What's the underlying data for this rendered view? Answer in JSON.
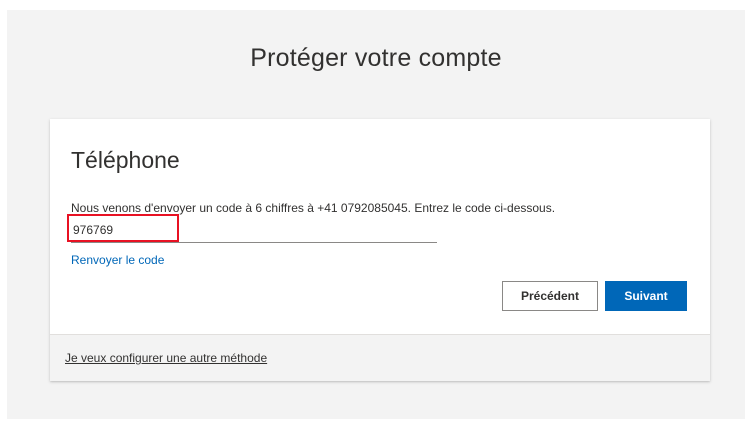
{
  "page": {
    "title": "Protéger votre compte"
  },
  "card": {
    "title": "Téléphone",
    "instruction": "Nous venons d'envoyer un code à 6 chiffres à +41 0792085045. Entrez le code ci-dessous.",
    "code_input": {
      "value": "976769",
      "placeholder": ""
    },
    "resend_link": "Renvoyer le code",
    "buttons": {
      "previous": "Précédent",
      "next": "Suivant"
    },
    "footer": {
      "other_method_link": "Je veux configurer une autre méthode"
    }
  },
  "colors": {
    "accent": "#0067b8",
    "highlight": "#e81123",
    "background": "#f3f3f3"
  }
}
